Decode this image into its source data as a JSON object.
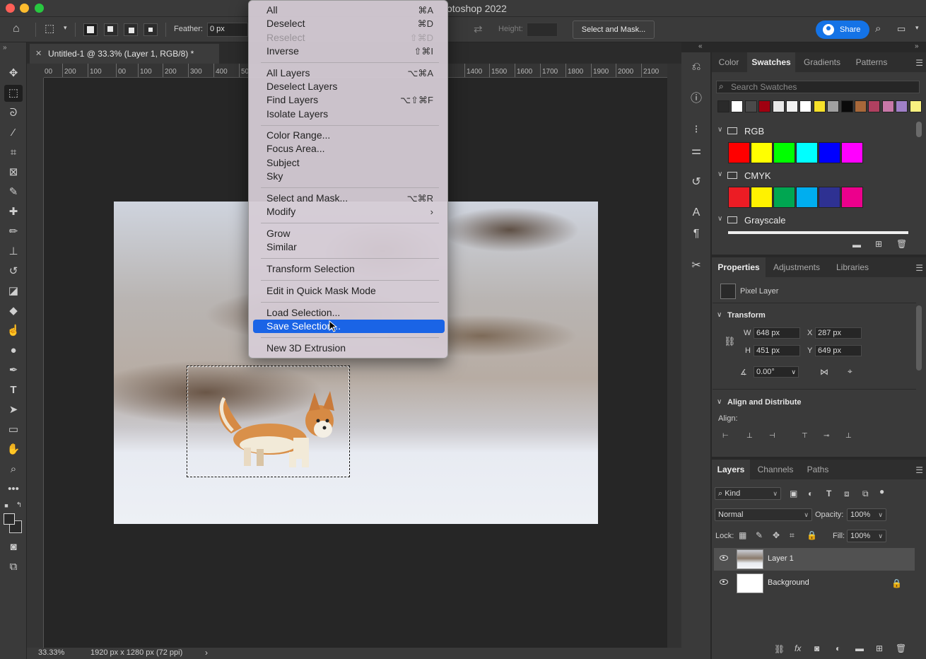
{
  "app": {
    "title": "otoshop 2022"
  },
  "options": {
    "feather_label": "Feather:",
    "feather_value": "0 px",
    "height_label": "Height:",
    "select_and_mask": "Select and Mask...",
    "share": "Share"
  },
  "document": {
    "tab_title": "Untitled-1 @ 33.3% (Layer 1, RGB/8) *",
    "zoom": "33.33%",
    "size_info": "1920 px x 1280 px (72 ppi)"
  },
  "ruler": {
    "top": [
      "00",
      "200",
      "100",
      "00",
      "100",
      "200",
      "300",
      "400",
      "50",
      "1400",
      "1500",
      "1600",
      "1700",
      "1800",
      "1900",
      "2000",
      "2100"
    ]
  },
  "menu": {
    "items": [
      {
        "label": "All",
        "shortcut": "⌘A",
        "disabled": false
      },
      {
        "label": "Deselect",
        "shortcut": "⌘D",
        "disabled": false
      },
      {
        "label": "Reselect",
        "shortcut": "⇧⌘D",
        "disabled": true
      },
      {
        "label": "Inverse",
        "shortcut": "⇧⌘I",
        "disabled": false
      },
      {
        "label": "All Layers",
        "shortcut": "⌥⌘A",
        "disabled": false
      },
      {
        "label": "Deselect Layers",
        "shortcut": "",
        "disabled": false
      },
      {
        "label": "Find Layers",
        "shortcut": "⌥⇧⌘F",
        "disabled": false
      },
      {
        "label": "Isolate Layers",
        "shortcut": "",
        "disabled": false
      },
      {
        "label": "Color Range...",
        "shortcut": "",
        "disabled": false
      },
      {
        "label": "Focus Area...",
        "shortcut": "",
        "disabled": false
      },
      {
        "label": "Subject",
        "shortcut": "",
        "disabled": false
      },
      {
        "label": "Sky",
        "shortcut": "",
        "disabled": false
      },
      {
        "label": "Select and Mask...",
        "shortcut": "⌥⌘R",
        "disabled": false
      },
      {
        "label": "Modify",
        "shortcut": "›",
        "disabled": false
      },
      {
        "label": "Grow",
        "shortcut": "",
        "disabled": false
      },
      {
        "label": "Similar",
        "shortcut": "",
        "disabled": false
      },
      {
        "label": "Transform Selection",
        "shortcut": "",
        "disabled": false
      },
      {
        "label": "Edit in Quick Mask Mode",
        "shortcut": "",
        "disabled": false
      },
      {
        "label": "Load Selection...",
        "shortcut": "",
        "disabled": false
      },
      {
        "label": "Save Selection...",
        "shortcut": "",
        "disabled": false,
        "highlighted": true
      },
      {
        "label": "New 3D Extrusion",
        "shortcut": "",
        "disabled": false
      }
    ]
  },
  "swatches_panel": {
    "tabs": [
      "Color",
      "Swatches",
      "Gradients",
      "Patterns"
    ],
    "active_tab": "Swatches",
    "search_placeholder": "Search Swatches",
    "recent": [
      "#2a2a2a",
      "#ffffff",
      "#4a4a4a",
      "#a00010",
      "#e8e8e8",
      "#f0f0f0",
      "#ffffff",
      "#f5e02a",
      "#a0a0a0",
      "#0a0a0a",
      "#a8683a",
      "#b04060",
      "#c878a8",
      "#a080c8",
      "#f8f080"
    ],
    "groups": [
      {
        "name": "RGB",
        "colors": [
          "#ff0000",
          "#ffff00",
          "#00ff00",
          "#00ffff",
          "#0000ff",
          "#ff00ff"
        ]
      },
      {
        "name": "CMYK",
        "colors": [
          "#ec1c24",
          "#fff200",
          "#00a651",
          "#00aeef",
          "#2e3192",
          "#ec008c"
        ]
      },
      {
        "name": "Grayscale",
        "colors": []
      }
    ]
  },
  "properties_panel": {
    "tabs": [
      "Properties",
      "Adjustments",
      "Libraries"
    ],
    "active_tab": "Properties",
    "layer_type": "Pixel Layer",
    "transform_heading": "Transform",
    "w_label": "W",
    "w_value": "648 px",
    "h_label": "H",
    "h_value": "451 px",
    "x_label": "X",
    "x_value": "287 px",
    "y_label": "Y",
    "y_value": "649 px",
    "angle_value": "0.00°",
    "align_heading": "Align and Distribute",
    "align_label": "Align:"
  },
  "layers_panel": {
    "tabs": [
      "Layers",
      "Channels",
      "Paths"
    ],
    "active_tab": "Layers",
    "kind_filter": "Kind",
    "blend_mode": "Normal",
    "opacity_label": "Opacity:",
    "opacity_value": "100%",
    "lock_label": "Lock:",
    "fill_label": "Fill:",
    "fill_value": "100%",
    "layers": [
      {
        "name": "Layer 1",
        "selected": true
      },
      {
        "name": "Background",
        "selected": false,
        "locked": true
      }
    ]
  },
  "colors": {
    "accent": "#1473e6",
    "menu_highlight": "#1a64e6"
  }
}
